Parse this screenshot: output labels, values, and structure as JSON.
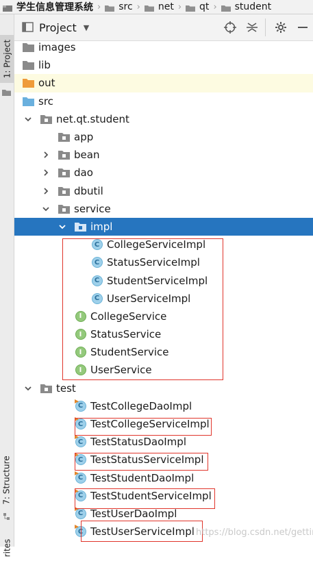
{
  "breadcrumb": [
    "学生信息管理系统",
    "src",
    "net",
    "qt",
    "student"
  ],
  "tool_strip": {
    "project_tab": "1: Project",
    "structure_tab": "7: Structure",
    "favorites_tab": "rites"
  },
  "header": {
    "title": "Project"
  },
  "tree": [
    {
      "label": "images",
      "icon": "folder-icon",
      "depth": 0,
      "arrow": "none"
    },
    {
      "label": "lib",
      "icon": "folder-icon",
      "depth": 0,
      "arrow": "none"
    },
    {
      "label": "out",
      "icon": "folder-orange-icon",
      "depth": 0,
      "arrow": "none",
      "highlight": true
    },
    {
      "label": "src",
      "icon": "source-folder-icon",
      "depth": 0,
      "arrow": "none"
    },
    {
      "label": "net.qt.student",
      "icon": "package-icon",
      "depth": 1,
      "arrow": "down"
    },
    {
      "label": "app",
      "icon": "package-icon",
      "depth": 2,
      "arrow": "none"
    },
    {
      "label": "bean",
      "icon": "package-icon",
      "depth": 2,
      "arrow": "right"
    },
    {
      "label": "dao",
      "icon": "package-icon",
      "depth": 2,
      "arrow": "right"
    },
    {
      "label": "dbutil",
      "icon": "package-icon",
      "depth": 2,
      "arrow": "right"
    },
    {
      "label": "service",
      "icon": "package-icon",
      "depth": 2,
      "arrow": "down"
    },
    {
      "label": "impl",
      "icon": "package-icon",
      "depth": 3,
      "arrow": "down",
      "selected": true
    },
    {
      "label": "CollegeServiceImpl",
      "icon": "class-icon",
      "depth": 4,
      "arrow": "none"
    },
    {
      "label": "StatusServiceImpl",
      "icon": "class-icon",
      "depth": 4,
      "arrow": "none"
    },
    {
      "label": "StudentServiceImpl",
      "icon": "class-icon",
      "depth": 4,
      "arrow": "none"
    },
    {
      "label": "UserServiceImpl",
      "icon": "class-icon",
      "depth": 4,
      "arrow": "none"
    },
    {
      "label": "CollegeService",
      "icon": "interface-icon",
      "depth": 3,
      "arrow": "none"
    },
    {
      "label": "StatusService",
      "icon": "interface-icon",
      "depth": 3,
      "arrow": "none"
    },
    {
      "label": "StudentService",
      "icon": "interface-icon",
      "depth": 3,
      "arrow": "none"
    },
    {
      "label": "UserService",
      "icon": "interface-icon",
      "depth": 3,
      "arrow": "none"
    },
    {
      "label": "test",
      "icon": "package-icon",
      "depth": 1,
      "arrow": "down"
    },
    {
      "label": "TestCollegeDaoImpl",
      "icon": "test-class-icon",
      "depth": 3,
      "arrow": "none"
    },
    {
      "label": "TestCollegeServiceImpl",
      "icon": "test-class-icon",
      "depth": 3,
      "arrow": "none"
    },
    {
      "label": "TestStatusDaoImpl",
      "icon": "test-class-icon",
      "depth": 3,
      "arrow": "none"
    },
    {
      "label": "TestStatusServiceImpl",
      "icon": "test-class-icon",
      "depth": 3,
      "arrow": "none"
    },
    {
      "label": "TestStudentDaoImpl",
      "icon": "test-class-icon",
      "depth": 3,
      "arrow": "none"
    },
    {
      "label": "TestStudentServiceImpl",
      "icon": "test-class-icon",
      "depth": 3,
      "arrow": "none"
    },
    {
      "label": "TestUserDaoImpl",
      "icon": "test-class-icon",
      "depth": 3,
      "arrow": "none"
    },
    {
      "label": "TestUserServiceImpl",
      "icon": "test-class-icon",
      "depth": 3,
      "arrow": "none"
    }
  ],
  "watermark": "https://blog.csdn.net/gettingi",
  "colors": {
    "selection": "#2675bf",
    "annotation": "#e0342a",
    "class_badge": "#9ed0ea",
    "interface_badge": "#94c97c"
  }
}
